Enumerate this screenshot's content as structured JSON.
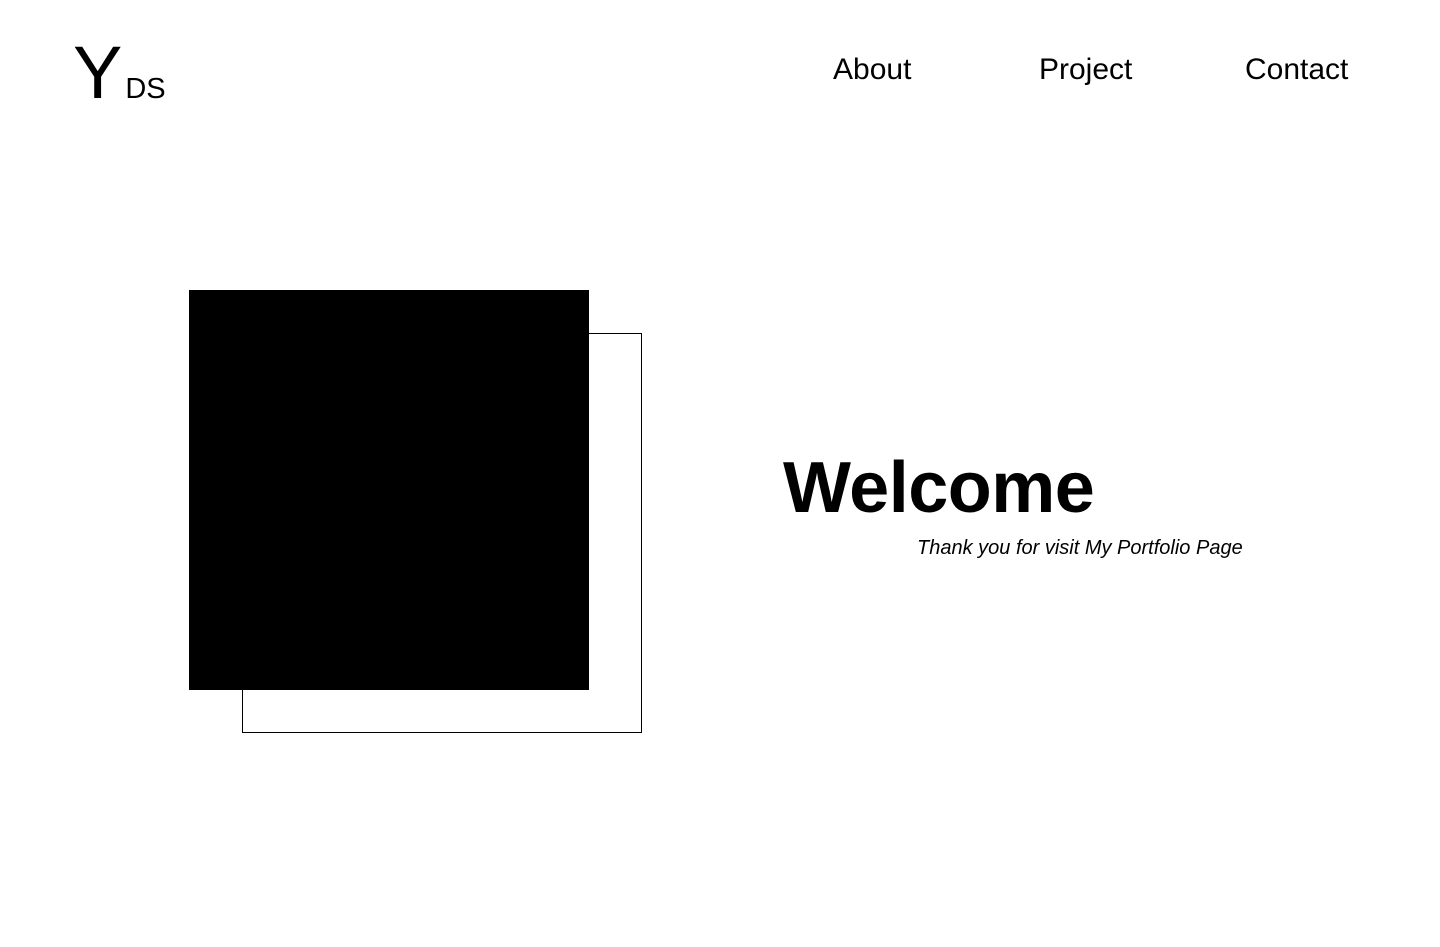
{
  "logo": {
    "main": "Y",
    "sub": "DS"
  },
  "nav": {
    "about": "About",
    "project": "Project",
    "contact": "Contact"
  },
  "hero": {
    "title": "Welcome",
    "subtitle": "Thank you for visit My Portfolio Page"
  },
  "colors": {
    "background": "#ffffff",
    "text": "#000000",
    "accent": "#000000"
  }
}
